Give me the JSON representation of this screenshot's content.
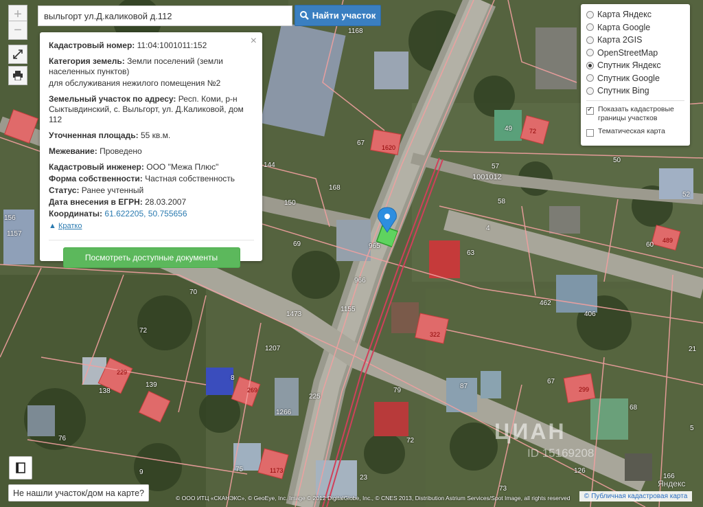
{
  "search": {
    "value": "выльгорт ул.Д.каликовой д.112",
    "button_label": "Найти участок"
  },
  "zoom": {
    "plus": "+",
    "minus": "−"
  },
  "info": {
    "cadastral_label": "Кадастровый номер:",
    "cadastral_value": "11:04:1001011:152",
    "category_label": "Категория земель:",
    "category_value": "Земли поселений (земли населенных пунктов)",
    "usage": "для обслуживания нежилого помещения №2",
    "address_label": "Земельный участок по адресу:",
    "address_value": "Респ. Коми, р-н Сыктывдинский, с. Выльгорт, ул. Д.Каликовой, дом 112",
    "area_label": "Уточненная площадь:",
    "area_value": "55 кв.м.",
    "survey_label": "Межевание:",
    "survey_value": "Проведено",
    "engineer_label": "Кадастровый инженер:",
    "engineer_value": "ООО \"Межа Плюс\"",
    "ownership_label": "Форма собственности:",
    "ownership_value": "Частная собственность",
    "status_label": "Статус:",
    "status_value": "Ранее учтенный",
    "egrn_label": "Дата внесения в ЕГРН:",
    "egrn_value": "28.03.2007",
    "coords_label": "Координаты:",
    "coords_value": "61.622205, 50.755656",
    "brief_link": "Кратко",
    "docs_button": "Посмотреть доступные документы",
    "close": "×"
  },
  "layers": {
    "options": [
      {
        "label": "Карта Яндекс",
        "selected": false
      },
      {
        "label": "Карта Google",
        "selected": false
      },
      {
        "label": "Карта 2GIS",
        "selected": false
      },
      {
        "label": "OpenStreetMap",
        "selected": false
      },
      {
        "label": "Спутник Яндекс",
        "selected": true
      },
      {
        "label": "Спутник Google",
        "selected": false
      },
      {
        "label": "Спутник Bing",
        "selected": false
      }
    ],
    "show_borders": "Показать кадастровые границы участков",
    "show_borders_checked": true,
    "thematic": "Тематическая карта",
    "thematic_checked": false
  },
  "map_labels": [
    "1168",
    "67",
    "1620",
    "49",
    "72",
    "57",
    "1001012",
    "50",
    "58",
    "52",
    "1157",
    "156",
    "144",
    "168",
    "150",
    "965",
    "69",
    "4",
    "60",
    "489",
    "63",
    "966",
    "462",
    "406",
    "1473",
    "1155",
    "70",
    "322",
    "1207",
    "72",
    "8",
    "139",
    "138",
    "229",
    "269",
    "1266",
    "225",
    "67",
    "299",
    "68",
    "79",
    "87",
    "76",
    "75",
    "1173",
    "72",
    "9",
    "23",
    "73",
    "126",
    "166",
    "5",
    "21"
  ],
  "not_found": "Не нашли участок/дом на карте?",
  "attribution": "© ООО ИТЦ «СКАНЭКС», © GeoEye, Inc. Image © 2012 DigitalGlobe, Inc., © CNES 2013, Distribution Astrium Services/Spot Image, all rights reserved",
  "pkk_link": "Публичная кадастровая карта",
  "yandex_logo": "Яндекс",
  "watermark": "ЦИАН",
  "watermark_id": "ID 15169208",
  "colors": {
    "accent_blue": "#3a7fc1",
    "docs_green": "#5cb85c",
    "parcel_red": "#e06060",
    "border_pink": "#f2a0a0"
  }
}
